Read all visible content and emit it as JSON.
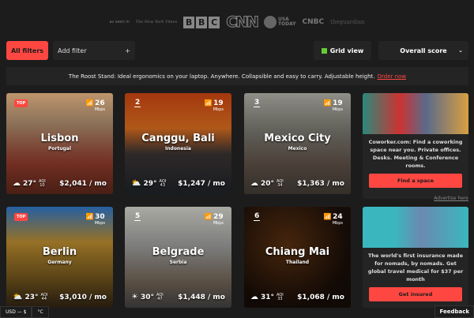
{
  "press": {
    "label": "as seen in",
    "logos": [
      "The New York Times",
      "B",
      "B",
      "C",
      "CNN",
      "USA",
      "TODAY",
      "CNBC",
      "theguardian"
    ]
  },
  "toolbar": {
    "all_filters": "All filters",
    "add_filter": "Add filter",
    "add_icon": "+",
    "grid_view": "Grid view",
    "sort": "Overall score",
    "chevron": "⌄"
  },
  "banner": {
    "text": "The Roost Stand: Ideal ergonomics on your laptop. Anywhere. Collapsible and easy to carry. Adjustable height.",
    "link": "Order now"
  },
  "cities": [
    {
      "rank": "TOP",
      "city": "Lisbon",
      "country": "Portugal",
      "speed": "26",
      "unit": "Mbps",
      "weather": "☁",
      "temp": "27°",
      "aqi_label": "AQI",
      "aqi": "10",
      "cost": "$2,041 / mo"
    },
    {
      "rank": "2",
      "city": "Canggu, Bali",
      "country": "Indonesia",
      "speed": "19",
      "unit": "Mbps",
      "weather": "⛅",
      "temp": "29°",
      "aqi_label": "AQI",
      "aqi": "43",
      "cost": "$1,247 / mo"
    },
    {
      "rank": "3",
      "city": "Mexico City",
      "country": "Mexico",
      "speed": "19",
      "unit": "Mbps",
      "weather": "☁",
      "temp": "20°",
      "aqi_label": "AQI",
      "aqi": "34",
      "cost": "$1,363 / mo"
    },
    {
      "rank": "TOP",
      "city": "Berlin",
      "country": "Germany",
      "speed": "30",
      "unit": "Mbps",
      "weather": "⛅",
      "temp": "23°",
      "aqi_label": "AQI",
      "aqi": "44",
      "cost": "$3,010 / mo"
    },
    {
      "rank": "5",
      "city": "Belgrade",
      "country": "Serbia",
      "speed": "29",
      "unit": "Mbps",
      "weather": "☀",
      "temp": "30°",
      "aqi_label": "AQI",
      "aqi": "47",
      "cost": "$1,448 / mo"
    },
    {
      "rank": "6",
      "city": "Chiang Mai",
      "country": "Thailand",
      "speed": "24",
      "unit": "Mbps",
      "weather": "☁",
      "temp": "31°",
      "aqi_label": "AQI",
      "aqi": "33",
      "cost": "$1,068 / mo"
    }
  ],
  "ads": [
    {
      "text": "Coworker.com: Find a coworking space near you. Private offices. Desks. Meeting & Conference rooms.",
      "cta": "Find a space"
    },
    {
      "text": "The world's first insurance made for nomads, by nomads. Get global travel medical for $37 per month",
      "cta": "Get insured"
    }
  ],
  "advertise": "Advertise here",
  "footer": {
    "currency": "USD — $",
    "units": "°C",
    "feedback": "Feedback"
  },
  "colors": {
    "accent": "#ff4742",
    "background": "#1c1c1c"
  }
}
